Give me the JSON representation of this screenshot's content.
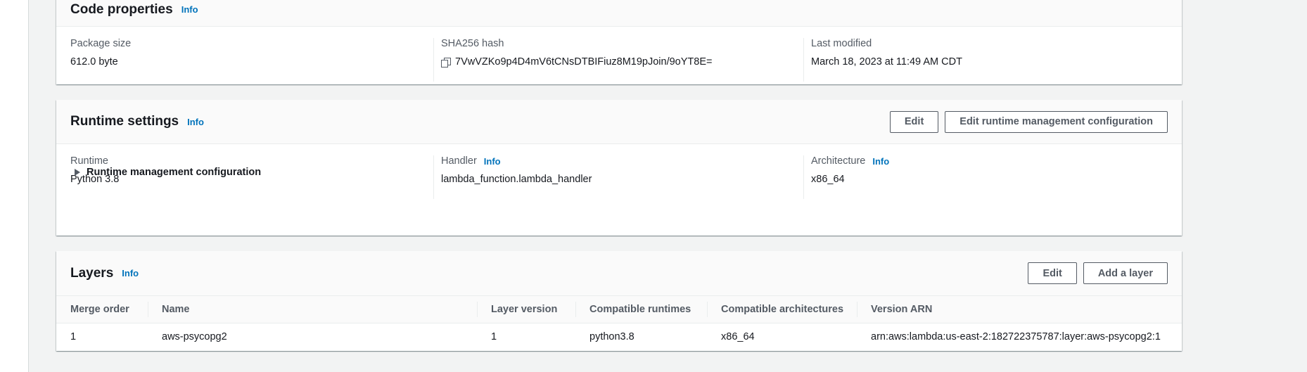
{
  "code_properties": {
    "title": "Code properties",
    "info": "Info",
    "package_size_label": "Package size",
    "package_size": "612.0 byte",
    "sha_label": "SHA256 hash",
    "sha": "7VwVZKo9p4D4mV6tCNsDTBIFiuz8M19pJoin/9oYT8E=",
    "modified_label": "Last modified",
    "modified": "March 18, 2023 at 11:49 AM CDT"
  },
  "runtime_settings": {
    "title": "Runtime settings",
    "info": "Info",
    "edit": "Edit",
    "edit_runtime": "Edit runtime management configuration",
    "runtime_label": "Runtime",
    "runtime": "Python 3.8",
    "handler_label": "Handler",
    "handler_info": "Info",
    "handler": "lambda_function.lambda_handler",
    "arch_label": "Architecture",
    "arch_info": "Info",
    "arch": "x86_64",
    "expand": "Runtime management configuration"
  },
  "layers": {
    "title": "Layers",
    "info": "Info",
    "edit": "Edit",
    "add": "Add a layer",
    "columns": [
      "Merge order",
      "Name",
      "Layer version",
      "Compatible runtimes",
      "Compatible architectures",
      "Version ARN"
    ],
    "rows": [
      [
        "1",
        "aws-psycopg2",
        "1",
        "python3.8",
        "x86_64",
        "arn:aws:lambda:us-east-2:182722375787:layer:aws-psycopg2:1"
      ]
    ]
  }
}
